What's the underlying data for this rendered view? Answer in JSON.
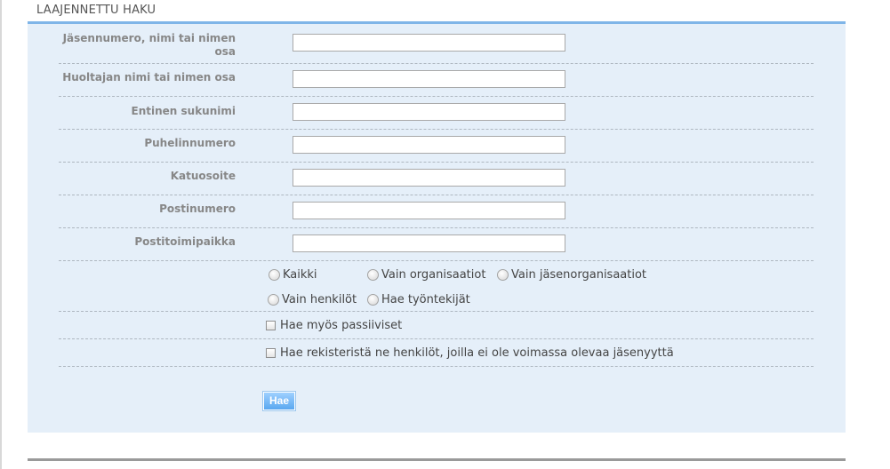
{
  "section": {
    "title": "LAAJENNETTU HAKU"
  },
  "fields": [
    {
      "label_line1": "Jäsennumero, nimi tai nimen",
      "label_line2": "osa",
      "value": ""
    },
    {
      "label": "Huoltajan nimi tai nimen osa",
      "value": ""
    },
    {
      "label": "Entinen sukunimi",
      "value": ""
    },
    {
      "label": "Puhelinnumero",
      "value": ""
    },
    {
      "label": "Katuosoite",
      "value": ""
    },
    {
      "label": "Postinumero",
      "value": ""
    },
    {
      "label": "Postitoimipaikka",
      "value": ""
    }
  ],
  "search_type": {
    "options": [
      "Kaikki",
      "Vain organisaatiot",
      "Vain jäsenorganisaatiot",
      "Vain henkilöt",
      "Hae työntekijät"
    ],
    "selected": null
  },
  "checkboxes": [
    {
      "label": "Hae myös passiiviset",
      "checked": false
    },
    {
      "label": "Hae rekisteristä ne henkilöt, joilla ei ole voimassa olevaa jäsenyyttä",
      "checked": false
    }
  ],
  "search_button": {
    "label": "Hae"
  }
}
